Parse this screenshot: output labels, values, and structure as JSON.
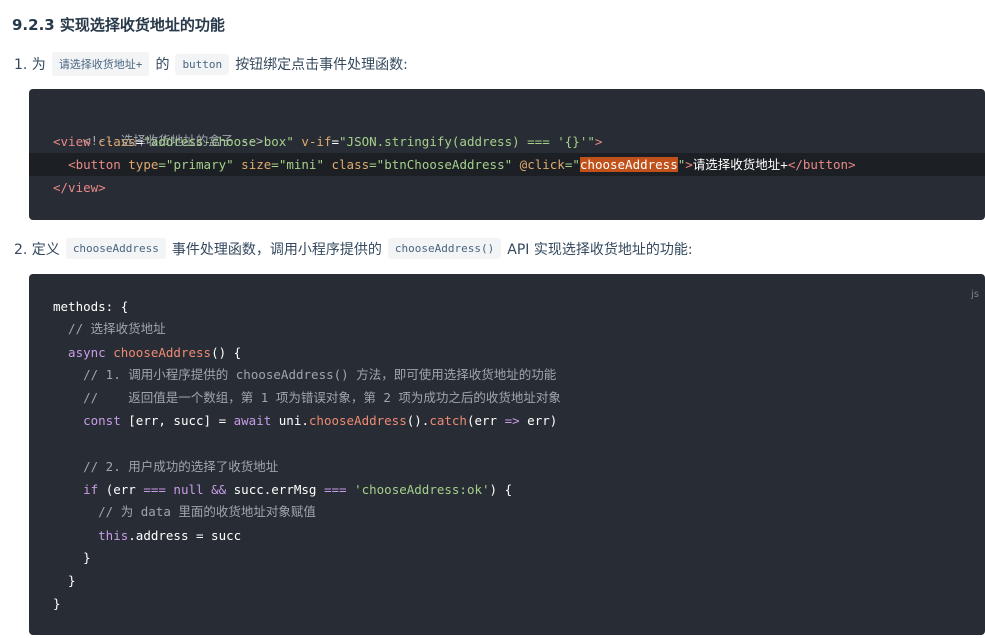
{
  "heading": "9.2.3 实现选择收货地址的功能",
  "step1": {
    "prefix": "1. 为",
    "chip1": "请选择收货地址+",
    "mid": "的",
    "chip2": "button",
    "suffix": "按钮绑定点击事件处理函数:"
  },
  "code1": {
    "lines": {
      "l1": "<!-- 选择收货地址的盒子 -->",
      "l2_tag": "<view",
      "l2_a1": " class",
      "l2_eq1": "=",
      "l2_v1": "\"address-choose-box\"",
      "l2_a2": " v-if",
      "l2_eq2": "=",
      "l2_v2": "\"JSON.stringify(address) === '{}'\"",
      "l2_end": ">",
      "l3_indent": "  ",
      "l3_tag": "<button",
      "l3_a1": " type",
      "l3_v1": "=\"primary\"",
      "l3_a2": " size",
      "l3_v2": "=\"mini\"",
      "l3_a3": " class",
      "l3_v3": "=\"btnChooseAddress\"",
      "l3_a4": " @click",
      "l3_q1": "=\"",
      "l3_sel": "chooseAddress",
      "l3_q2": "\"",
      "l3_gt": ">",
      "l3_text": "请选择收货地址+",
      "l3_close": "</button>",
      "l4": "</view>"
    }
  },
  "step2": {
    "prefix": "2. 定义",
    "chip1": "chooseAddress",
    "mid": "事件处理函数，调用小程序提供的",
    "chip2": "chooseAddress()",
    "suffix": "API 实现选择收货地址的功能:"
  },
  "code2": {
    "lang": "js",
    "l1": "methods: {",
    "l2": "  // 选择收货地址",
    "l3_kw": "  async ",
    "l3_fn": "chooseAddress",
    "l3_rest": "() {",
    "l4": "    // 1. 调用小程序提供的 chooseAddress() 方法，即可使用选择收货地址的功能",
    "l5": "    //    返回值是一个数组，第 1 项为错误对象，第 2 项为成功之后的收货地址对象",
    "l6_kw": "    const ",
    "l6_a": "[err, succ] = ",
    "l6_kw2": "await ",
    "l6_b": "uni.",
    "l6_fn": "chooseAddress",
    "l6_c": "().",
    "l6_fn2": "catch",
    "l6_d": "(err ",
    "l6_kw3": "=>",
    "l6_e": " err)",
    "l8": "    // 2. 用户成功的选择了收货地址",
    "l9_kw": "    if ",
    "l9_a": "(err ",
    "l9_op": "===",
    "l9_kw2": " null ",
    "l9_op2": "&&",
    "l9_b": " succ.errMsg ",
    "l9_op3": "===",
    "l9_str": " 'chooseAddress:ok'",
    "l9_c": ") {",
    "l10": "      // 为 data 里面的收货地址对象赋值",
    "l11_kw": "      this",
    "l11_rest": ".address = succ",
    "l12": "    }",
    "l13": "  }",
    "l14": "}"
  }
}
